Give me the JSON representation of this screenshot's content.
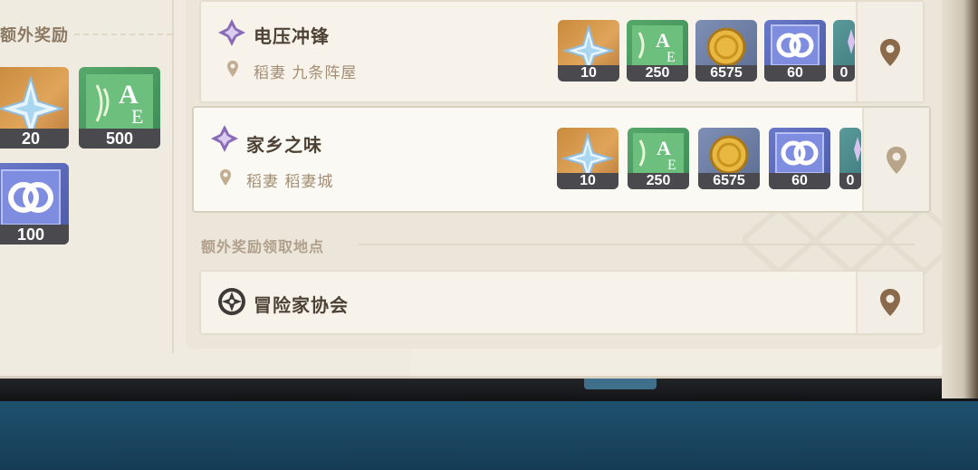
{
  "left_panel": {
    "section_title": "额外奖励",
    "rewards": [
      {
        "icon": "primogem-icon",
        "count": "20"
      },
      {
        "icon": "adventure-exp-icon",
        "count": "500"
      },
      {
        "icon": "friendship-exp-icon",
        "count": "100"
      }
    ]
  },
  "quests": [
    {
      "title": "电压冲锋",
      "location": "稻妻 九条阵屋",
      "rewards": [
        {
          "icon": "primogem-icon",
          "count": "10"
        },
        {
          "icon": "adventure-exp-icon",
          "count": "250"
        },
        {
          "icon": "mora-icon",
          "count": "6575"
        },
        {
          "icon": "friendship-exp-icon",
          "count": "60"
        },
        {
          "icon": "crystal-icon",
          "count": "0"
        }
      ]
    },
    {
      "title": "家乡之味",
      "location": "稻妻 稻妻城",
      "rewards": [
        {
          "icon": "primogem-icon",
          "count": "10"
        },
        {
          "icon": "adventure-exp-icon",
          "count": "250"
        },
        {
          "icon": "mora-icon",
          "count": "6575"
        },
        {
          "icon": "friendship-exp-icon",
          "count": "60"
        },
        {
          "icon": "crystal-icon",
          "count": "0"
        }
      ]
    }
  ],
  "claim_section": {
    "label": "额外奖励领取地点",
    "location_title": "冒险家协会"
  },
  "colors": {
    "accent": "#8a6a4a",
    "pin_inactive": "#b8a488",
    "pin_active": "#8a6a4a"
  }
}
